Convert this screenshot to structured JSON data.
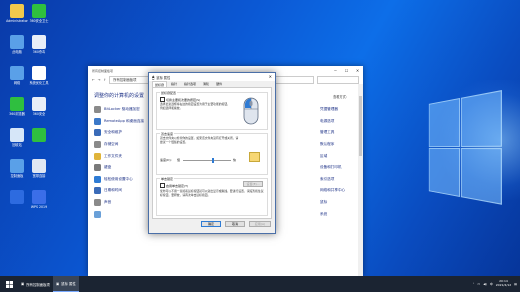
{
  "desktop": {
    "icons": [
      {
        "label": "Administrator",
        "icon": "user-folder-icon",
        "color": "#f2c94c"
      },
      {
        "label": "360安全卫士",
        "icon": "shield-icon",
        "color": "#2fbf3f"
      },
      {
        "label": "此电脑",
        "icon": "computer-icon",
        "color": "#5aa0e8"
      },
      {
        "label": "360杀毒",
        "icon": "antivirus-icon",
        "color": "#e8eef8"
      },
      {
        "label": "网络",
        "icon": "network-icon",
        "color": "#5aa0e8"
      },
      {
        "label": "系统优化工具",
        "icon": "document-icon",
        "color": "#ffffff"
      },
      {
        "label": "360浏览器",
        "icon": "browser-icon",
        "color": "#2fbf3f"
      },
      {
        "label": "360安全",
        "icon": "safe-icon",
        "color": "#e8eef8"
      },
      {
        "label": "回收站",
        "icon": "recycle-bin-icon",
        "color": "#d6e6f8"
      },
      {
        "label": "",
        "icon": "ie-icon",
        "color": "#2fbf3f"
      },
      {
        "label": "控制面板",
        "icon": "control-panel-icon",
        "color": "#5aa0e8"
      },
      {
        "label": "宽带连接",
        "icon": "broadband-icon",
        "color": "#dfe7f3"
      },
      {
        "label": "",
        "icon": "sogou-icon",
        "color": "#2d6be0"
      },
      {
        "label": "WPS 2019",
        "icon": "wps-icon",
        "color": "#3b6ee8"
      }
    ]
  },
  "control_panel": {
    "title": "所有控制面板项",
    "address": "所有控制面板项",
    "heading": "调整你的计算机的设置",
    "view_by": "查看方式：",
    "items": [
      {
        "label": "BitLocker 驱动器加密",
        "color": "#8a8a8a"
      },
      {
        "label": "RemoteApp 和桌面连接",
        "color": "#3b78c8"
      },
      {
        "label": "安全和维护",
        "color": "#3a6bb8"
      },
      {
        "label": "存储空间",
        "color": "#8a8a8a"
      },
      {
        "label": "工作文件夹",
        "color": "#e0b43a"
      },
      {
        "label": "键盘",
        "color": "#7a7a7a"
      },
      {
        "label": "轻松使用设置中心",
        "color": "#2e7bd4"
      },
      {
        "label": "日期和时间",
        "color": "#3a6bb8"
      },
      {
        "label": "声音",
        "color": "#8a8a8a"
      },
      {
        "label": "",
        "color": "#6aa0d8"
      }
    ],
    "right_column": [
      "凭据管理器",
      "电源选项",
      "管理工具",
      "默认程序",
      "区域",
      "设备和打印机",
      "索引选项",
      "网络和共享中心",
      "鼠标",
      "系统"
    ]
  },
  "mouse_dialog": {
    "title": "鼠标 属性",
    "tabs": [
      "鼠标键",
      "指针",
      "指针选项",
      "滑轮",
      "硬件"
    ],
    "active_tab": 0,
    "group1": {
      "label": "鼠标键配置",
      "checkbox": "切换主要和次要的按钮(S)",
      "desc": "选择此复选框将右边的按钮设置为用于主要功能的按钮，例如选择和拖放。"
    },
    "group2": {
      "label": "双击速度",
      "desc": "双击文件夹以检查你的设置。如果该文件夹没有打开或关闭，请尝试一个慢些的设置。",
      "speed_label": "速度(D):",
      "slow": "慢",
      "fast": "快",
      "speed_value": 0.62
    },
    "group3": {
      "label": "单击锁定",
      "checkbox": "启用单击锁定(T)",
      "settings_button": "设置(E)...",
      "desc": "使你可以不用一直按着鼠标按钮就可以突出显示或拖拽。要进行设置，请短暂按住鼠标按钮。要释放，请再次单击鼠标按钮。"
    },
    "buttons": {
      "ok": "确定",
      "cancel": "取消",
      "apply": "应用(A)"
    }
  },
  "taskbar": {
    "apps": [
      {
        "label": "所有控制面板项",
        "icon": "control-panel-icon",
        "active": false
      },
      {
        "label": "鼠标 属性",
        "icon": "mouse-icon",
        "active": true
      }
    ],
    "time": "20:14",
    "date": "2021/4/12",
    "ime": "中"
  }
}
